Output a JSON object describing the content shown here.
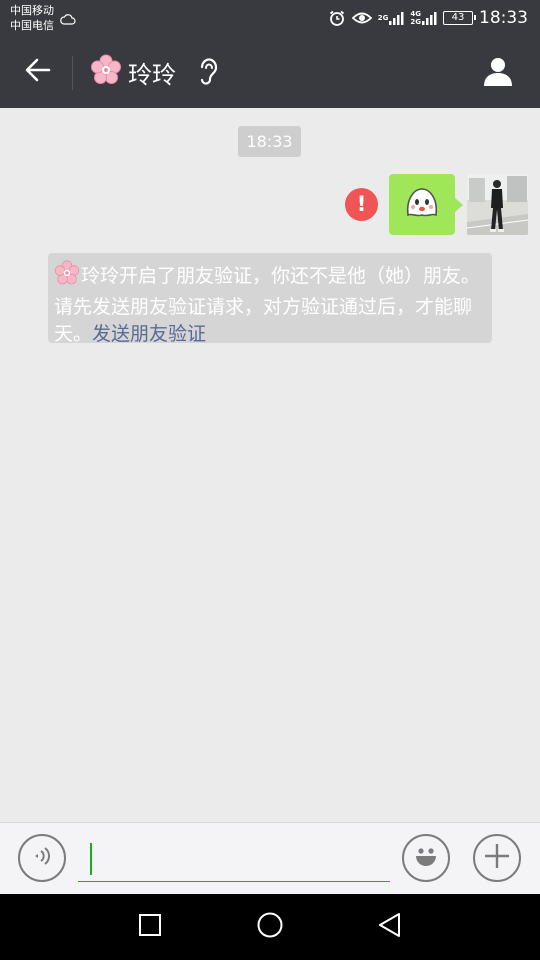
{
  "status_bar": {
    "carrier_1": "中国移动",
    "carrier_2": "中国电信",
    "net_1_top": "2G",
    "net_2_top": "4G",
    "net_2_bottom": "2G",
    "battery": "43",
    "time": "18:33"
  },
  "title_bar": {
    "title": "玲玲",
    "back_icon": "arrow-left-icon",
    "ear_icon": "ear-icon",
    "profile_icon": "person-icon",
    "flower_icon": "cherry-blossom-icon"
  },
  "chat": {
    "timestamp": "18:33",
    "error_symbol": "!",
    "sent_message_icon": "ghost-sticker-icon",
    "notice_text": "玲玲开启了朋友验证，你还不是他（她）朋友。请先发送朋友验证请求，对方验证通过后，才能聊天。",
    "notice_link": "发送朋友验证"
  },
  "input_bar": {
    "value": "",
    "voice_icon": "voice-icon",
    "emoji_icon": "smiley-icon",
    "plus_icon": "plus-icon"
  },
  "nav_bar": {
    "recent_icon": "square-icon",
    "home_icon": "circle-icon",
    "back_icon": "triangle-back-icon"
  },
  "colors": {
    "header_bg": "#393a3f",
    "chat_bg": "#ebebeb",
    "bubble_green": "#9fe658",
    "error_red": "#f05454",
    "link_blue": "#576b95",
    "input_green": "#1aad19"
  }
}
